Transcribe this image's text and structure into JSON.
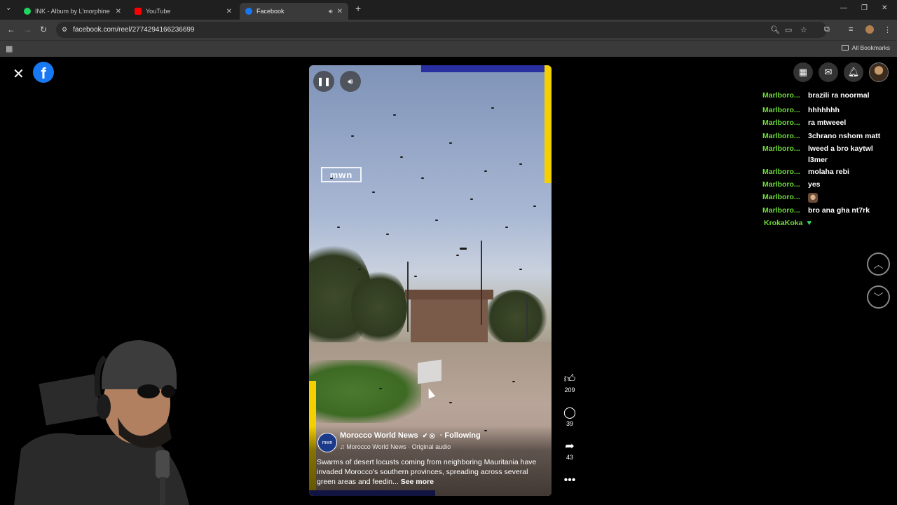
{
  "browser": {
    "tabs": [
      {
        "title": "INK - Album by L'morphine | Sp",
        "favicon_color": "#1ed760"
      },
      {
        "title": "YouTube",
        "favicon_color": "#ff0000"
      },
      {
        "title": "Facebook",
        "favicon_color": "#1877f2"
      }
    ],
    "url": "facebook.com/reel/2774294166236699",
    "all_bookmarks": "All Bookmarks"
  },
  "reel": {
    "watermark": "mwn",
    "page_avatar_text": "mwn",
    "page_name": "Morocco World News",
    "following_label": "· Following",
    "audio": "♫ Morocco World News · Original audio",
    "description": "Swarms of desert locusts coming from neighboring Mauritania have invaded Morocco's southern provinces, spreading across several green areas and feedin...",
    "see_more": "See more"
  },
  "actions": {
    "likes": "209",
    "comments": "39",
    "shares": "43"
  },
  "chat": {
    "lines": [
      {
        "user": "Marlboro...",
        "msg": "brazili ra noormal"
      },
      {
        "user": "Marlboro...",
        "msg": "hhhhhhh"
      },
      {
        "user": "Marlboro...",
        "msg": "ra mtweeel"
      },
      {
        "user": "Marlboro...",
        "msg": "3chrano nshom matt"
      },
      {
        "user": "Marlboro...",
        "msg": "lweed a bro kaytwl l3mer"
      },
      {
        "user": "Marlboro...",
        "msg": "molaha rebi"
      },
      {
        "user": "Marlboro...",
        "msg": "yes"
      },
      {
        "user": "Marlboro...",
        "msg": ""
      },
      {
        "user": "Marlboro...",
        "msg": "bro ana gha nt7rk"
      }
    ],
    "last_user": "KrokaKoka"
  }
}
